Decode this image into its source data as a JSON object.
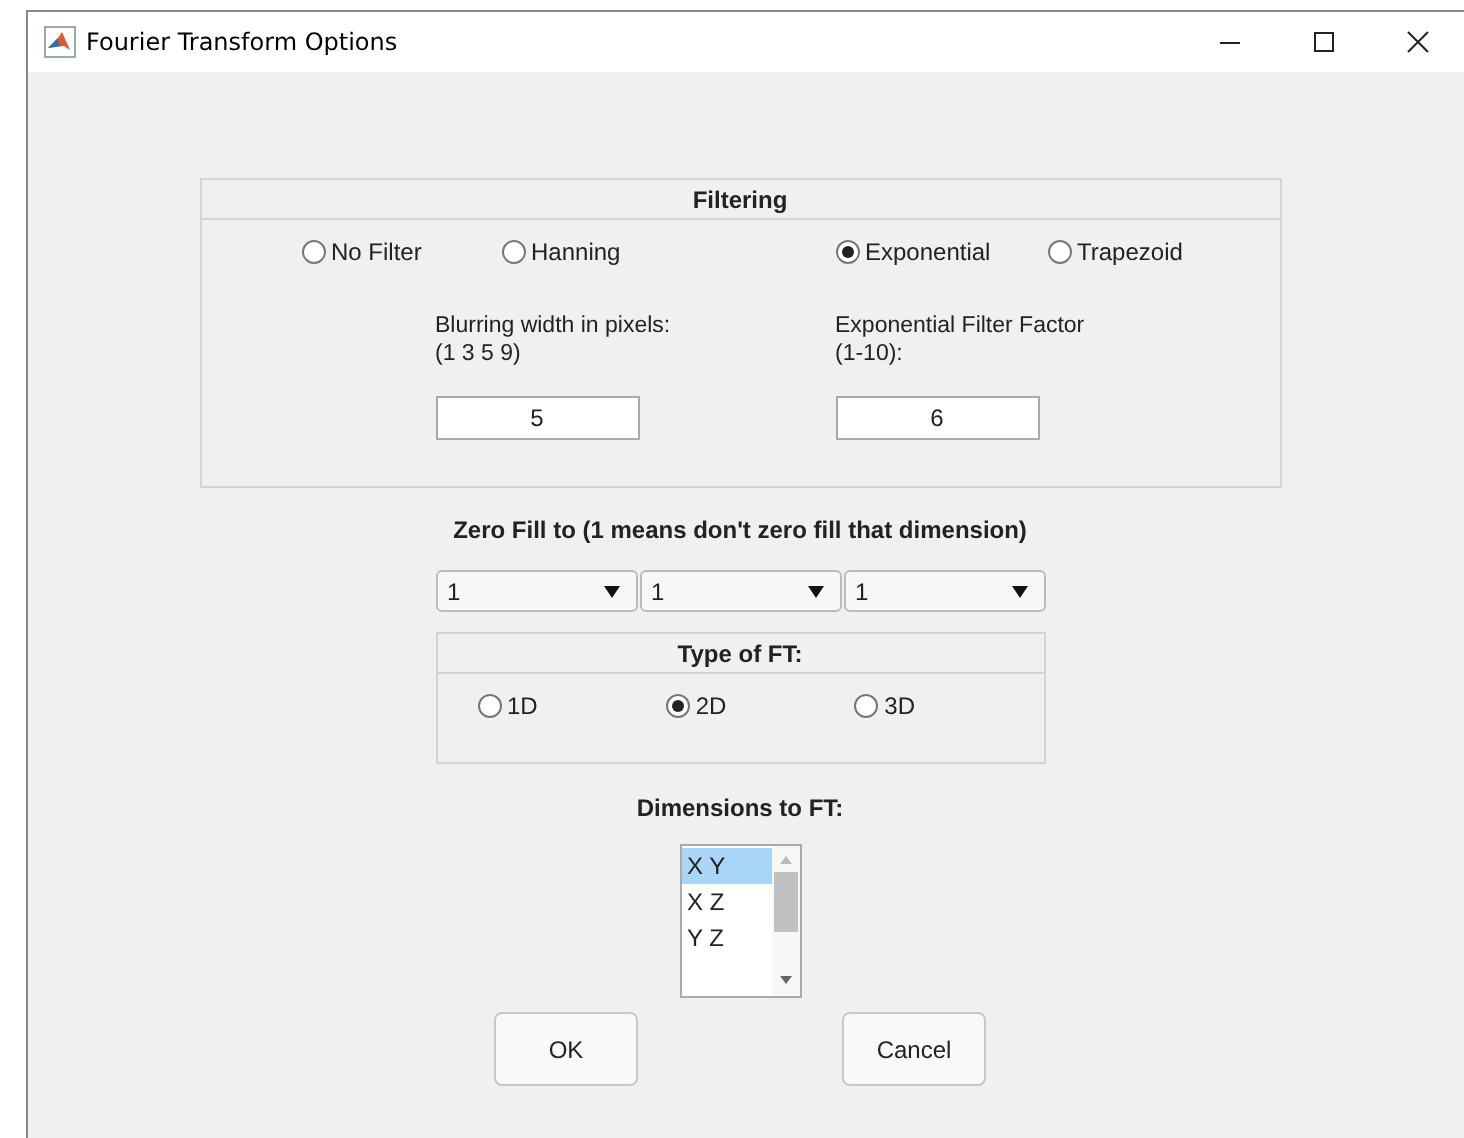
{
  "window": {
    "title": "Fourier Transform Options"
  },
  "filtering": {
    "title": "Filtering",
    "filters": [
      {
        "label": "No Filter",
        "selected": false
      },
      {
        "label": "Hanning",
        "selected": false
      },
      {
        "label": "Exponential",
        "selected": true
      },
      {
        "label": "Trapezoid",
        "selected": false
      }
    ],
    "fields": [
      {
        "label": "Blurring width in pixels:\n(1 3 5 9)",
        "value": "5"
      },
      {
        "label": "Exponential Filter Factor\n(1-10):",
        "value": "6"
      }
    ]
  },
  "zero_fill": {
    "label": "Zero Fill to (1 means don't zero fill that dimension)",
    "dropdowns": [
      "1",
      "1",
      "1"
    ]
  },
  "type_of_ft": {
    "title": "Type of FT:",
    "options": [
      {
        "label": "1D",
        "selected": false
      },
      {
        "label": "2D",
        "selected": true
      },
      {
        "label": "3D",
        "selected": false
      }
    ]
  },
  "dimensions": {
    "label": "Dimensions to FT:",
    "items": [
      {
        "label": "X Y",
        "selected": true
      },
      {
        "label": "X Z",
        "selected": false
      },
      {
        "label": "Y Z",
        "selected": false
      }
    ]
  },
  "buttons": [
    "OK",
    "Cancel"
  ]
}
